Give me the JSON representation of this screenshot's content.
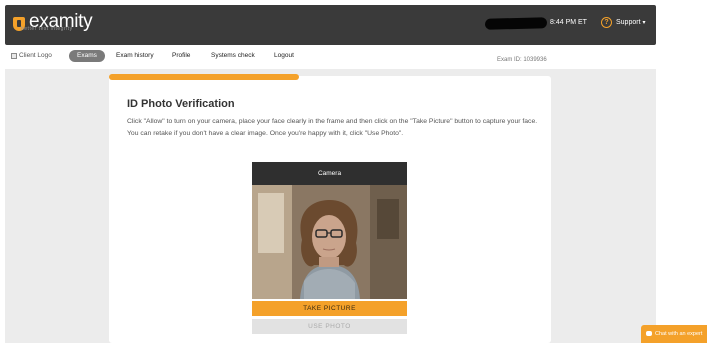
{
  "header": {
    "logo_text": "examity",
    "logo_tagline": "better test integrity",
    "time": "8:44 PM ET",
    "support_label": "Support",
    "support_caret": "▾",
    "help_glyph": "?"
  },
  "nav": {
    "client_logo_alt": "Client Logo",
    "items": [
      {
        "label": "Exams",
        "active": true
      },
      {
        "label": "Exam history"
      },
      {
        "label": "Profile"
      },
      {
        "label": "Systems check"
      },
      {
        "label": "Logout"
      }
    ],
    "exam_id": "Exam ID: 1039936"
  },
  "progress": {
    "fraction": 0.43
  },
  "page": {
    "title": "ID Photo Verification",
    "description": "Click \"Allow\" to turn on your camera, place your face clearly in the frame and then click on the \"Take Picture\" button to capture your face. You can retake if you don't have a clear image. Once you're happy with it, click \"Use Photo\"."
  },
  "camera": {
    "header": "Camera",
    "take_picture": "TAKE PICTURE",
    "use_photo": "USE PHOTO"
  },
  "chat": {
    "label": "Chat with an expert"
  },
  "colors": {
    "accent": "#f4a12a",
    "topbar": "#3a3a3a",
    "page_bg": "#ececec"
  }
}
